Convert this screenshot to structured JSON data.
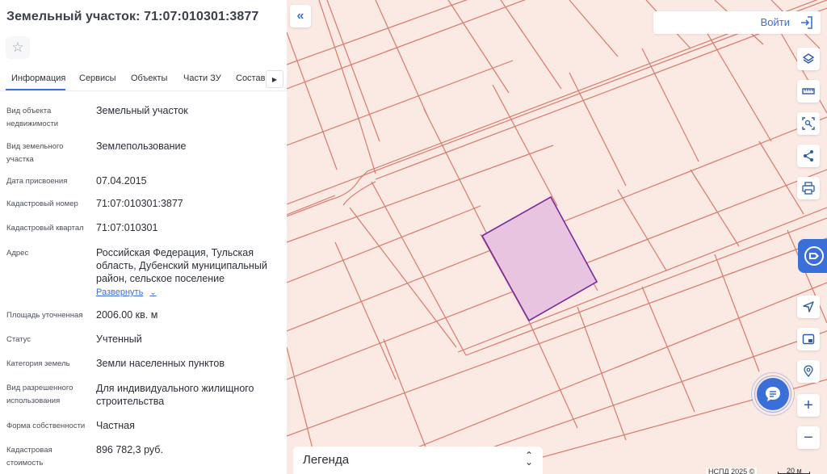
{
  "panel": {
    "title": "Земельный участок: 71:07:010301:3877",
    "tabs": [
      "Информация",
      "Сервисы",
      "Объекты",
      "Части ЗУ",
      "Состав"
    ],
    "properties": [
      {
        "label": "Вид объекта недвижимости",
        "value": "Земельный участок"
      },
      {
        "label": "Вид земельного участка",
        "value": "Землепользование"
      },
      {
        "label": "Дата присвоения",
        "value": "07.04.2015"
      },
      {
        "label": "Кадастровый номер",
        "value": "71:07:010301:3877"
      },
      {
        "label": "Кадастровый квартал",
        "value": "71:07:010301"
      },
      {
        "label": "Адрес",
        "value": "Российская Федерация, Тульская область, Дубенский муниципальный район, сельское поселение"
      },
      {
        "label": "Площадь уточненная",
        "value": "2006.00 кв. м"
      },
      {
        "label": "Статус",
        "value": "Учтенный"
      },
      {
        "label": "Категория земель",
        "value": "Земли населенных пунктов"
      },
      {
        "label": "Вид разрешенного использования",
        "value": "Для индивидуального жилищного строительства"
      },
      {
        "label": "Форма собственности",
        "value": "Частная"
      },
      {
        "label": "Кадастровая стоимость",
        "value": "896 782,3 руб."
      }
    ],
    "expand_label": "Развернуть"
  },
  "map": {
    "login_label": "Войти",
    "legend_label": "Легенда",
    "attribution": "НСПД 2025 ©",
    "scale_label": "20 м",
    "colors": {
      "background": "#fbe9e4",
      "parcel_lines": "#d97a6a",
      "highlight_fill": "#e8c4e0",
      "highlight_stroke": "#7a2a9a",
      "accent": "#3a6fd8"
    }
  },
  "icons": {
    "favorite": "star-icon",
    "collapse": "double-chevron-left-icon",
    "login": "login-icon",
    "layers": "layers-icon",
    "measure": "ruler-icon",
    "select_area": "select-area-icon",
    "share": "share-icon",
    "print": "printer-icon",
    "gosuslugi": "gosuslugi-icon",
    "locate": "navigation-arrow-icon",
    "minimap": "minimap-icon",
    "geo": "geo-search-icon",
    "chat": "chat-icon",
    "zoom_in": "plus-icon",
    "zoom_out": "minus-icon"
  }
}
